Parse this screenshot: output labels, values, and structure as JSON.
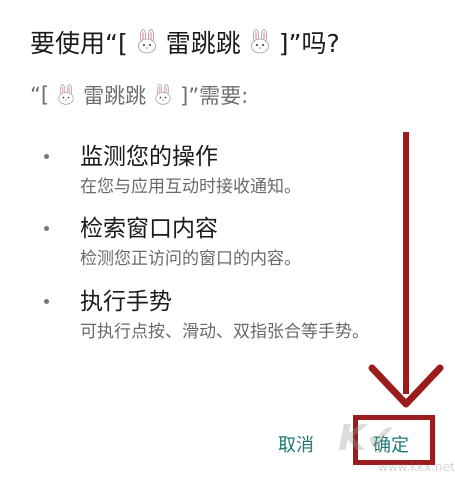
{
  "dialog": {
    "title_prefix": "要使用“[",
    "app_name": "雷跳跳",
    "title_suffix": "]”吗?",
    "subtitle_prefix": "“[",
    "subtitle_suffix": "]”需要:"
  },
  "permissions": [
    {
      "title": "监测您的操作",
      "description": "在您与应用互动时接收通知。"
    },
    {
      "title": "检索窗口内容",
      "description": "检测您正访问的窗口的内容。"
    },
    {
      "title": "执行手势",
      "description": "可执行点按、滑动、双指张合等手势。"
    }
  ],
  "buttons": {
    "cancel": "取消",
    "ok": "确定"
  },
  "annotation": {
    "color": "#9b1c1c"
  },
  "watermark": {
    "url": "www.kkx.net"
  },
  "colors": {
    "accent": "#1b7a74",
    "text_primary": "#1a1a1a",
    "text_secondary": "#6a6a6a"
  },
  "icons": {
    "app_icon": "rabbit-face-icon",
    "arrow": "down-arrow-annotation"
  }
}
